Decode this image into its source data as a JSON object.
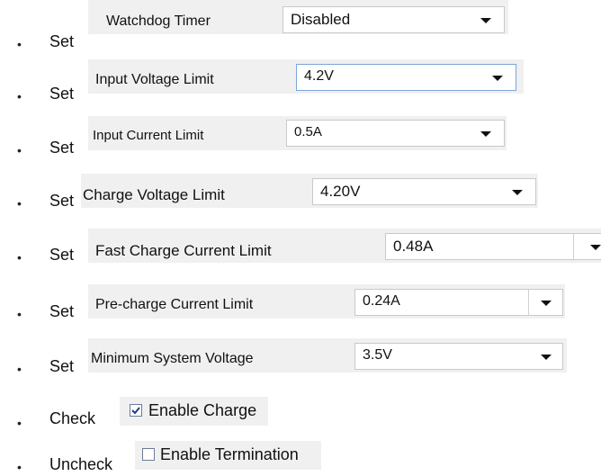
{
  "rows": [
    {
      "verb": "Set",
      "label": "Watchdog Timer",
      "value": "Disabled"
    },
    {
      "verb": "Set",
      "label": "Input Voltage Limit",
      "value": "4.2V"
    },
    {
      "verb": "Set",
      "label": "Input Current Limit",
      "value": "0.5A"
    },
    {
      "verb": "Set",
      "label": "Charge Voltage Limit",
      "value": "4.20V"
    },
    {
      "verb": "Set",
      "label": "Fast Charge Current Limit",
      "value": "0.48A"
    },
    {
      "verb": "Set",
      "label": "Pre-charge Current Limit",
      "value": "0.24A"
    },
    {
      "verb": "Set",
      "label": "Minimum System Voltage",
      "value": "3.5V"
    }
  ],
  "checks": [
    {
      "verb": "Check",
      "label": "Enable Charge",
      "checked": true
    },
    {
      "verb": "Uncheck",
      "label": "Enable Termination",
      "checked": false
    }
  ],
  "bullet_char": "•"
}
